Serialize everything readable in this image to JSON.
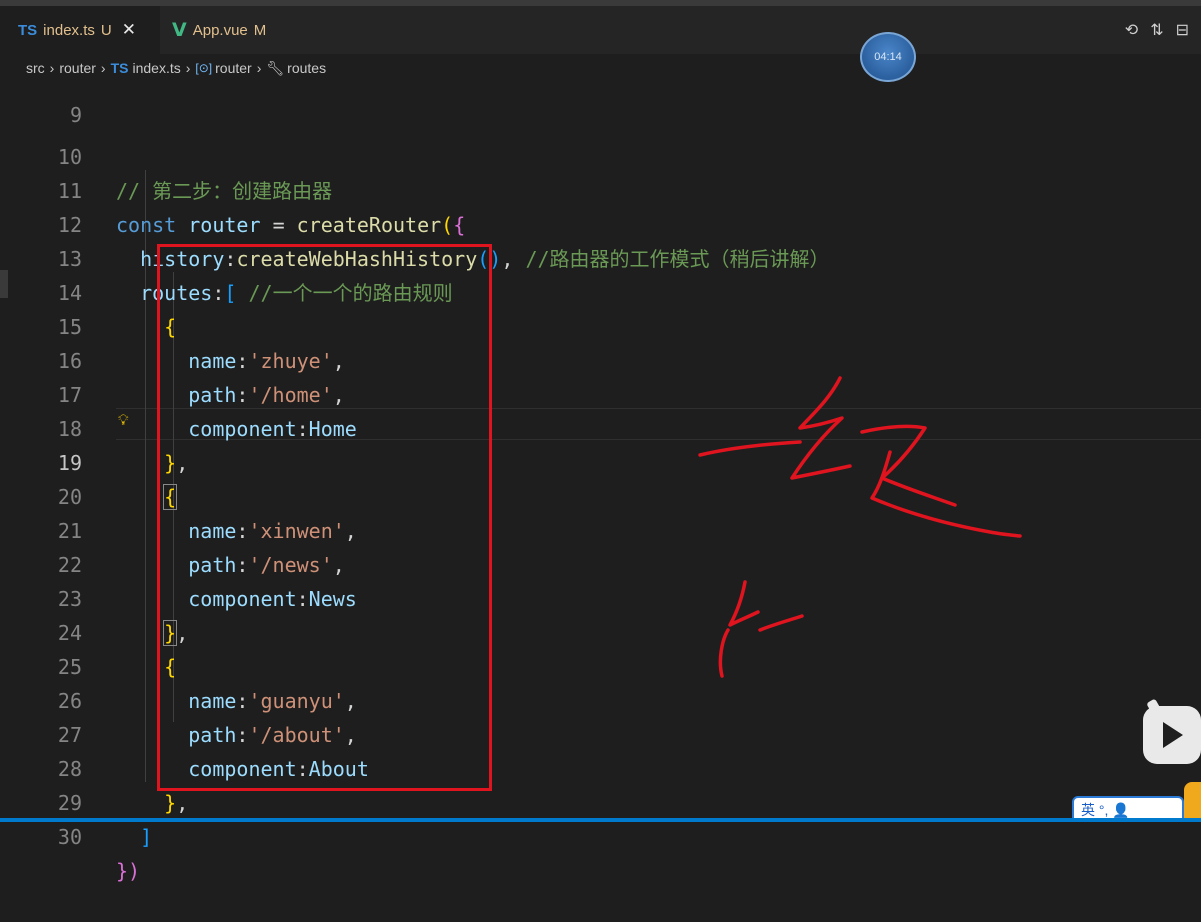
{
  "tabs": [
    {
      "badge": "TS",
      "name": "index.ts",
      "status": "U",
      "close": "✕"
    },
    {
      "badge": "V",
      "name": "App.vue",
      "status": "M"
    }
  ],
  "tab_icons": [
    "history-icon",
    "source-control-icon",
    "split-editor-icon"
  ],
  "timer": "04:14",
  "breadcrumb": {
    "parts": [
      "src",
      "router",
      "index.ts",
      "router",
      "routes"
    ],
    "ts_badge": "TS",
    "symbol_icon": "[⊙]"
  },
  "editor": {
    "line_numbers": [
      "9",
      "10",
      "11",
      "12",
      "13",
      "14",
      "15",
      "16",
      "17",
      "18",
      "19",
      "20",
      "21",
      "22",
      "23",
      "24",
      "25",
      "26",
      "27",
      "28",
      "29",
      "30"
    ],
    "active_line": "19",
    "code": {
      "l10": {
        "comment": "// 第二步：创建路由器"
      },
      "l11": {
        "kw": "const",
        "var": "router",
        "op": "=",
        "fn": "createRouter",
        "paren": "(",
        "brace": "{"
      },
      "l12": {
        "key": "history",
        "colon": ":",
        "fn": "createWebHashHistory",
        "parens": "()",
        "comma": ",",
        "comment": "//路由器的工作模式（稍后讲解）"
      },
      "l13": {
        "key": "routes",
        "colon": ":",
        "bracket": "[",
        "comment": "//一个一个的路由规则"
      },
      "routes": [
        {
          "name": "'zhuye'",
          "path": "'/home'",
          "component": "Home"
        },
        {
          "name": "'xinwen'",
          "path": "'/news'",
          "component": "News"
        },
        {
          "name": "'guanyu'",
          "path": "'/about'",
          "component": "About"
        }
      ],
      "keys": {
        "name": "name",
        "path": "path",
        "component": "component"
      },
      "l29": "]",
      "l30": "})"
    }
  },
  "handwriting": {
    "word1": "一级",
    "word2": "子"
  },
  "ime": {
    "label": "英 °, 👤"
  },
  "colors": {
    "annotation_red": "#e0141e",
    "accent": "#007acc"
  }
}
